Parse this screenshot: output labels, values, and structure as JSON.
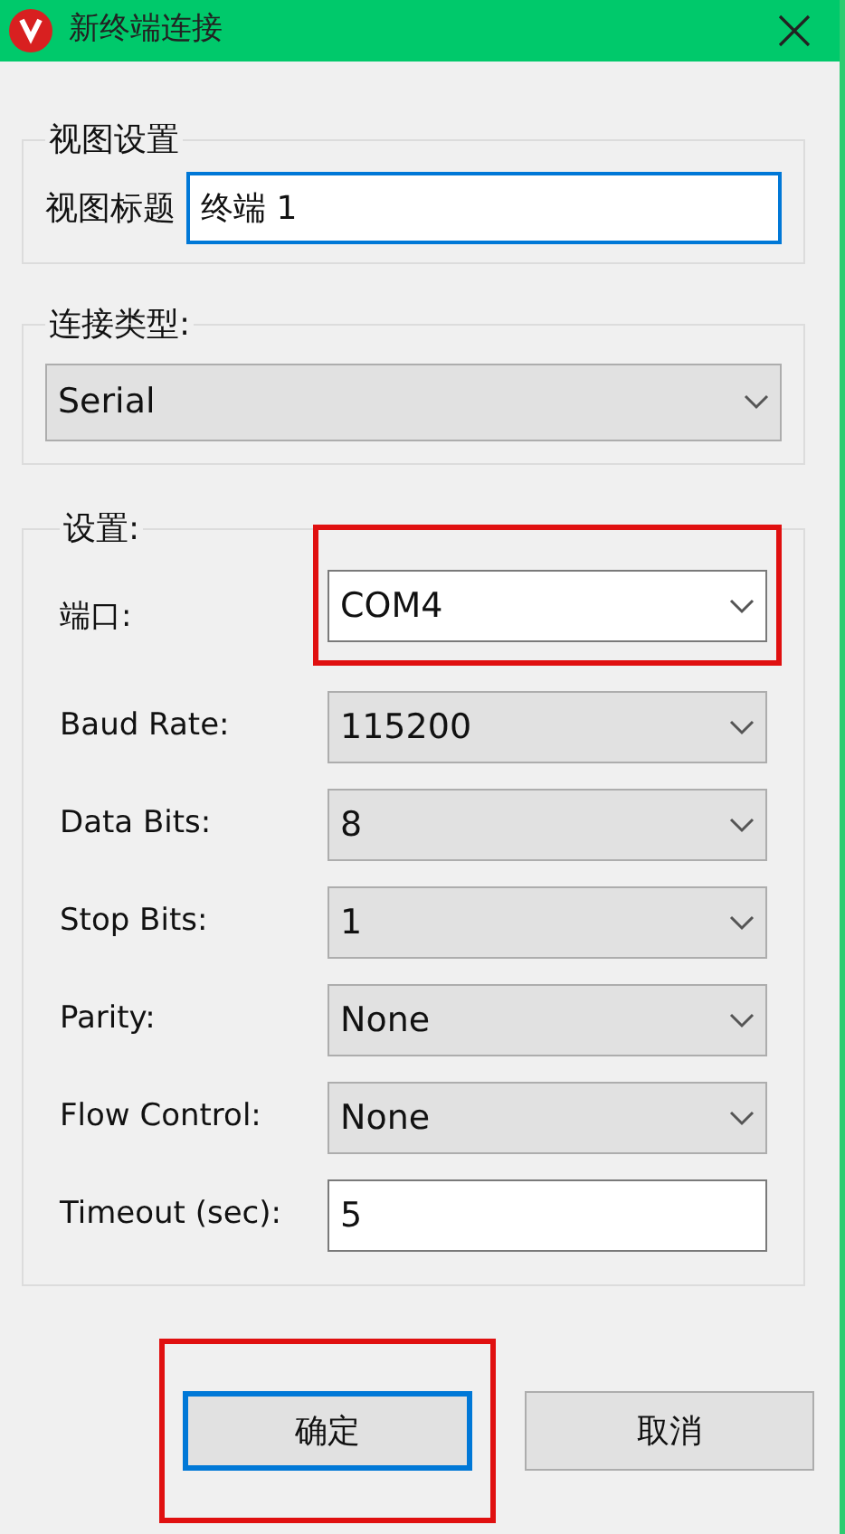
{
  "window": {
    "title": "新终端连接"
  },
  "view_group": {
    "legend": "视图设置",
    "label": "视图标题",
    "value": "终端 1",
    "focused": true
  },
  "connection_group": {
    "legend": "连接类型:",
    "value": "Serial"
  },
  "settings_group": {
    "legend": "设置:",
    "fields": [
      {
        "label": "端口:",
        "kind": "combo",
        "value": "COM4",
        "editable": true,
        "highlighted": true
      },
      {
        "label": "Baud Rate:",
        "kind": "combo",
        "value": "115200",
        "editable": false,
        "highlighted": false
      },
      {
        "label": "Data Bits:",
        "kind": "combo",
        "value": "8",
        "editable": false,
        "highlighted": false
      },
      {
        "label": "Stop Bits:",
        "kind": "combo",
        "value": "1",
        "editable": false,
        "highlighted": false
      },
      {
        "label": "Parity:",
        "kind": "combo",
        "value": "None",
        "editable": false,
        "highlighted": false
      },
      {
        "label": "Flow Control:",
        "kind": "combo",
        "value": "None",
        "editable": false,
        "highlighted": false
      },
      {
        "label": "Timeout (sec):",
        "kind": "text",
        "value": "5",
        "editable": true,
        "highlighted": false
      }
    ]
  },
  "buttons": [
    {
      "label": "确定",
      "default": true,
      "highlighted": true
    },
    {
      "label": "取消",
      "default": false,
      "highlighted": false
    }
  ]
}
